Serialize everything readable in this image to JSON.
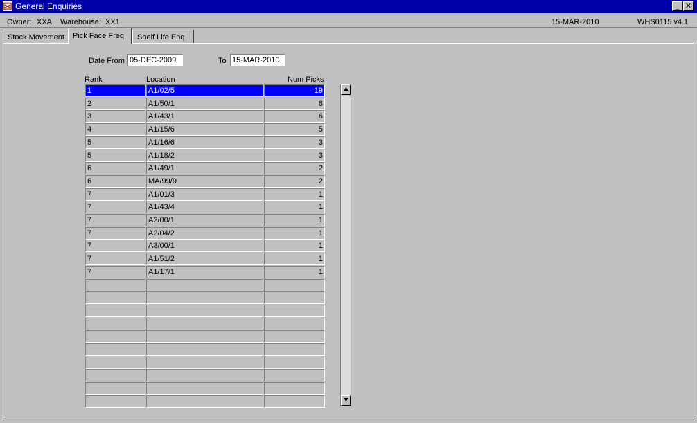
{
  "window": {
    "title": "General Enquiries",
    "minimize": "_",
    "close": "✕"
  },
  "info": {
    "owner_label": "Owner:",
    "owner": "XXA",
    "warehouse_label": "Warehouse:",
    "warehouse": "XX1",
    "date": "15-MAR-2010",
    "version": "WHS0115  v4.1"
  },
  "tabs": [
    {
      "label": "Stock Movement"
    },
    {
      "label": "Pick Face Freq"
    },
    {
      "label": "Shelf Life Enq"
    }
  ],
  "filters": {
    "date_from_label": "Date From",
    "date_from": "05-DEC-2009",
    "to_label": "To",
    "to": "15-MAR-2010"
  },
  "table": {
    "headers": {
      "rank": "Rank",
      "location": "Location",
      "num_picks": "Num Picks"
    },
    "rows": [
      {
        "rank": "1",
        "location": "A1/02/5",
        "num_picks": "19"
      },
      {
        "rank": "2",
        "location": "A1/50/1",
        "num_picks": "8"
      },
      {
        "rank": "3",
        "location": "A1/43/1",
        "num_picks": "6"
      },
      {
        "rank": "4",
        "location": "A1/15/6",
        "num_picks": "5"
      },
      {
        "rank": "5",
        "location": "A1/16/6",
        "num_picks": "3"
      },
      {
        "rank": "5",
        "location": "A1/18/2",
        "num_picks": "3"
      },
      {
        "rank": "6",
        "location": "A1/49/1",
        "num_picks": "2"
      },
      {
        "rank": "6",
        "location": "MA/99/9",
        "num_picks": "2"
      },
      {
        "rank": "7",
        "location": "A1/01/3",
        "num_picks": "1"
      },
      {
        "rank": "7",
        "location": "A1/43/4",
        "num_picks": "1"
      },
      {
        "rank": "7",
        "location": "A2/00/1",
        "num_picks": "1"
      },
      {
        "rank": "7",
        "location": "A2/04/2",
        "num_picks": "1"
      },
      {
        "rank": "7",
        "location": "A3/00/1",
        "num_picks": "1"
      },
      {
        "rank": "7",
        "location": "A1/51/2",
        "num_picks": "1"
      },
      {
        "rank": "7",
        "location": "A1/17/1",
        "num_picks": "1"
      },
      {
        "rank": "",
        "location": "",
        "num_picks": ""
      },
      {
        "rank": "",
        "location": "",
        "num_picks": ""
      },
      {
        "rank": "",
        "location": "",
        "num_picks": ""
      },
      {
        "rank": "",
        "location": "",
        "num_picks": ""
      },
      {
        "rank": "",
        "location": "",
        "num_picks": ""
      },
      {
        "rank": "",
        "location": "",
        "num_picks": ""
      },
      {
        "rank": "",
        "location": "",
        "num_picks": ""
      },
      {
        "rank": "",
        "location": "",
        "num_picks": ""
      },
      {
        "rank": "",
        "location": "",
        "num_picks": ""
      },
      {
        "rank": "",
        "location": "",
        "num_picks": ""
      }
    ]
  },
  "colors": {
    "title_bar": "#0000a8",
    "selected_row": "#0000ff",
    "background": "#c0c0c0"
  }
}
